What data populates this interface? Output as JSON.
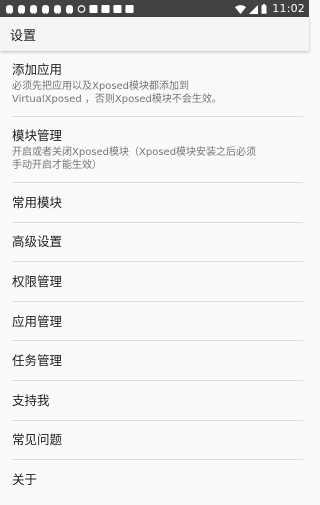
{
  "status_bar": {
    "time": "11:02",
    "notification_icons": [
      "android-icon",
      "android-icon",
      "android-icon",
      "android-icon",
      "android-icon",
      "android-icon",
      "sync-icon",
      "square-icon",
      "square-icon",
      "square-icon",
      "square-icon"
    ],
    "system_icons": [
      "wifi-icon",
      "signal-icon",
      "battery-icon"
    ],
    "background_color": "#424242"
  },
  "app_bar": {
    "title": "设置"
  },
  "settings": [
    {
      "id": "add-app",
      "title": "添加应用",
      "summary": "必须先把应用以及Xposed模块都添加到\nVirtualXposed ，否则Xposed模块不会生效。"
    },
    {
      "id": "module-manage",
      "title": "模块管理",
      "summary": "开启或者关闭Xposed模块（Xposed模块安装之后必须\n手动开启才能生效）"
    },
    {
      "id": "common-modules",
      "title": "常用模块"
    },
    {
      "id": "advanced-settings",
      "title": "高级设置"
    },
    {
      "id": "permission-manage",
      "title": "权限管理"
    },
    {
      "id": "app-manage",
      "title": "应用管理"
    },
    {
      "id": "task-manage",
      "title": "任务管理"
    },
    {
      "id": "support-me",
      "title": "支持我"
    },
    {
      "id": "faq",
      "title": "常见问题"
    },
    {
      "id": "about",
      "title": "关于"
    }
  ]
}
